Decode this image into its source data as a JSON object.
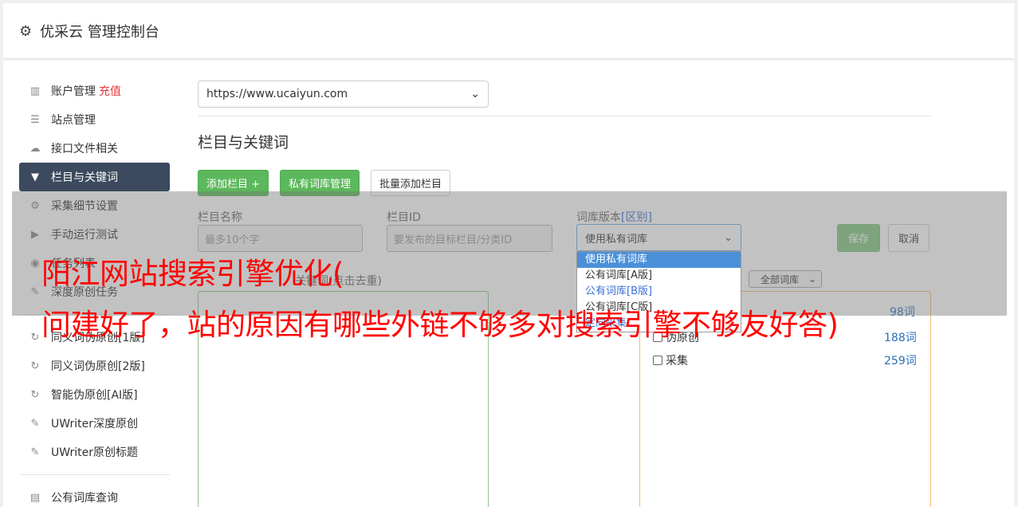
{
  "header": {
    "title": "优采云 管理控制台",
    "icon": "gear-icon"
  },
  "sidebar": {
    "items": [
      {
        "label": "账户管理",
        "extra": "充值",
        "icon": "bar-chart-icon"
      },
      {
        "label": "站点管理",
        "icon": "server-icon"
      },
      {
        "label": "接口文件相关",
        "icon": "cloud-upload-icon"
      },
      {
        "label": "栏目与关键词",
        "icon": "filter-icon",
        "active": true
      },
      {
        "label": "采集细节设置",
        "icon": "cogs-icon"
      },
      {
        "label": "手动运行测试",
        "icon": "play-circle-icon"
      },
      {
        "label": "任务列表",
        "icon": "database-icon"
      },
      {
        "label": "深度原创任务",
        "icon": "edit-icon"
      },
      {
        "label": "同义词伪原创[1版]",
        "icon": "refresh-icon"
      },
      {
        "label": "同义词伪原创[2版]",
        "icon": "refresh-icon"
      },
      {
        "label": "智能伪原创[AI版]",
        "icon": "refresh-icon"
      },
      {
        "label": "UWriter深度原创",
        "icon": "edit-icon"
      },
      {
        "label": "UWriter原创标题",
        "icon": "edit-icon"
      },
      {
        "label": "公有词库查询",
        "icon": "book-icon"
      }
    ]
  },
  "main": {
    "site_select": "https://www.ucaiyun.com",
    "section_title": "栏目与关键词",
    "buttons": {
      "add_column": "添加栏目 +",
      "private_lib": "私有词库管理",
      "batch_add": "批量添加栏目"
    },
    "form": {
      "name_label": "栏目名称",
      "name_placeholder": "最多10个字",
      "id_label": "栏目ID",
      "id_placeholder": "要发布的目标栏目/分类ID",
      "lib_label": "词库版本",
      "lib_label_link": "[区别]",
      "lib_value": "使用私有词库",
      "save": "保存",
      "cancel": "取消",
      "options": [
        "使用私有词库",
        "公有词库[A版]",
        "公有词库[B版]",
        "公有词库[C版]",
        "定向采集"
      ],
      "keywords_label": "关键词(点击去重)",
      "all_libs": "全部词库"
    },
    "lib_list": [
      {
        "name": "伪原创",
        "count": "188词"
      },
      {
        "name": "采集",
        "count": "259词"
      }
    ],
    "lib_list_top_count": "98词"
  },
  "watermark": {
    "line1": "阳江网站搜索引擎优化(",
    "line2": "问建好了，站的原因有哪些外链不够多对搜索引擎不够友好答)"
  }
}
